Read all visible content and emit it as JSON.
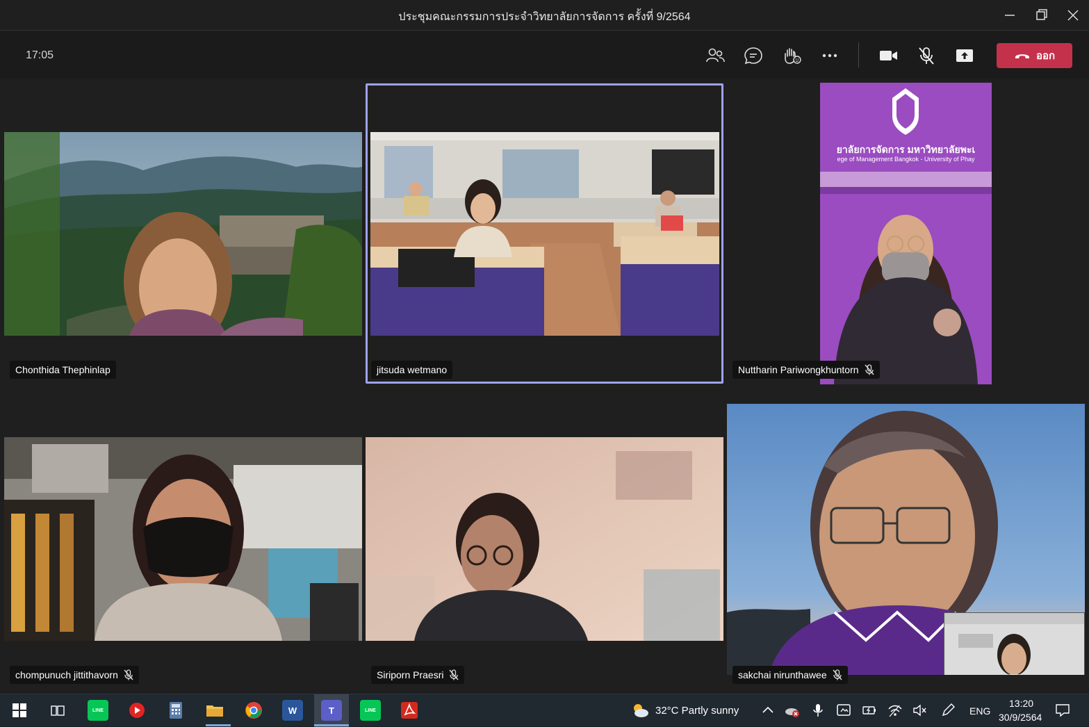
{
  "window": {
    "title": "ประชุมคณะกรรมการประจำวิทยาลัยการจัดการ ครั้งที่ 9/2564"
  },
  "toolbar": {
    "clock": "17:05",
    "leave_label": "ออก",
    "leave_color": "#c4314b",
    "icons": [
      "people-icon",
      "chat-icon",
      "raise-hand-icon",
      "more-icon",
      "camera-icon",
      "mic-muted-icon",
      "share-icon",
      "hang-up-icon"
    ]
  },
  "participants": [
    {
      "name": "Chonthida Thephinlap",
      "muted": false,
      "background": "mountain-landscape"
    },
    {
      "name": "jitsuda wetmano",
      "muted": false,
      "background": "meeting-room",
      "active_speaker": true
    },
    {
      "name": "Nuttharin Pariwongkhuntorn",
      "muted": true,
      "background": "purple-banner"
    },
    {
      "name": "chompunuch jittithavorn",
      "muted": true,
      "background": "office"
    },
    {
      "name": "Siriporn Praesri",
      "muted": true,
      "background": "blurred-room"
    },
    {
      "name": "sakchai nirunthawee",
      "muted": true,
      "background": "sky-beach"
    }
  ],
  "banner": {
    "line1": "ยาลัยการจัดการ มหาวิทยาลัยพะเ",
    "line2": "ege of Management Bangkok - University of Phay"
  },
  "active_frame_color": "#9ea2ff",
  "taskbar": {
    "apps": [
      "windows-start-icon",
      "task-view-icon",
      "line-app-icon",
      "media-player-icon",
      "calculator-icon",
      "file-explorer-icon",
      "chrome-icon",
      "word-icon",
      "teams-icon",
      "line-app-icon",
      "acrobat-icon"
    ],
    "word_label": "W",
    "teams_label": "T",
    "line_label": "LINE",
    "weather": "32°C  Partly sunny",
    "language": "ENG",
    "time": "13:20",
    "date": "30/9/2564"
  }
}
